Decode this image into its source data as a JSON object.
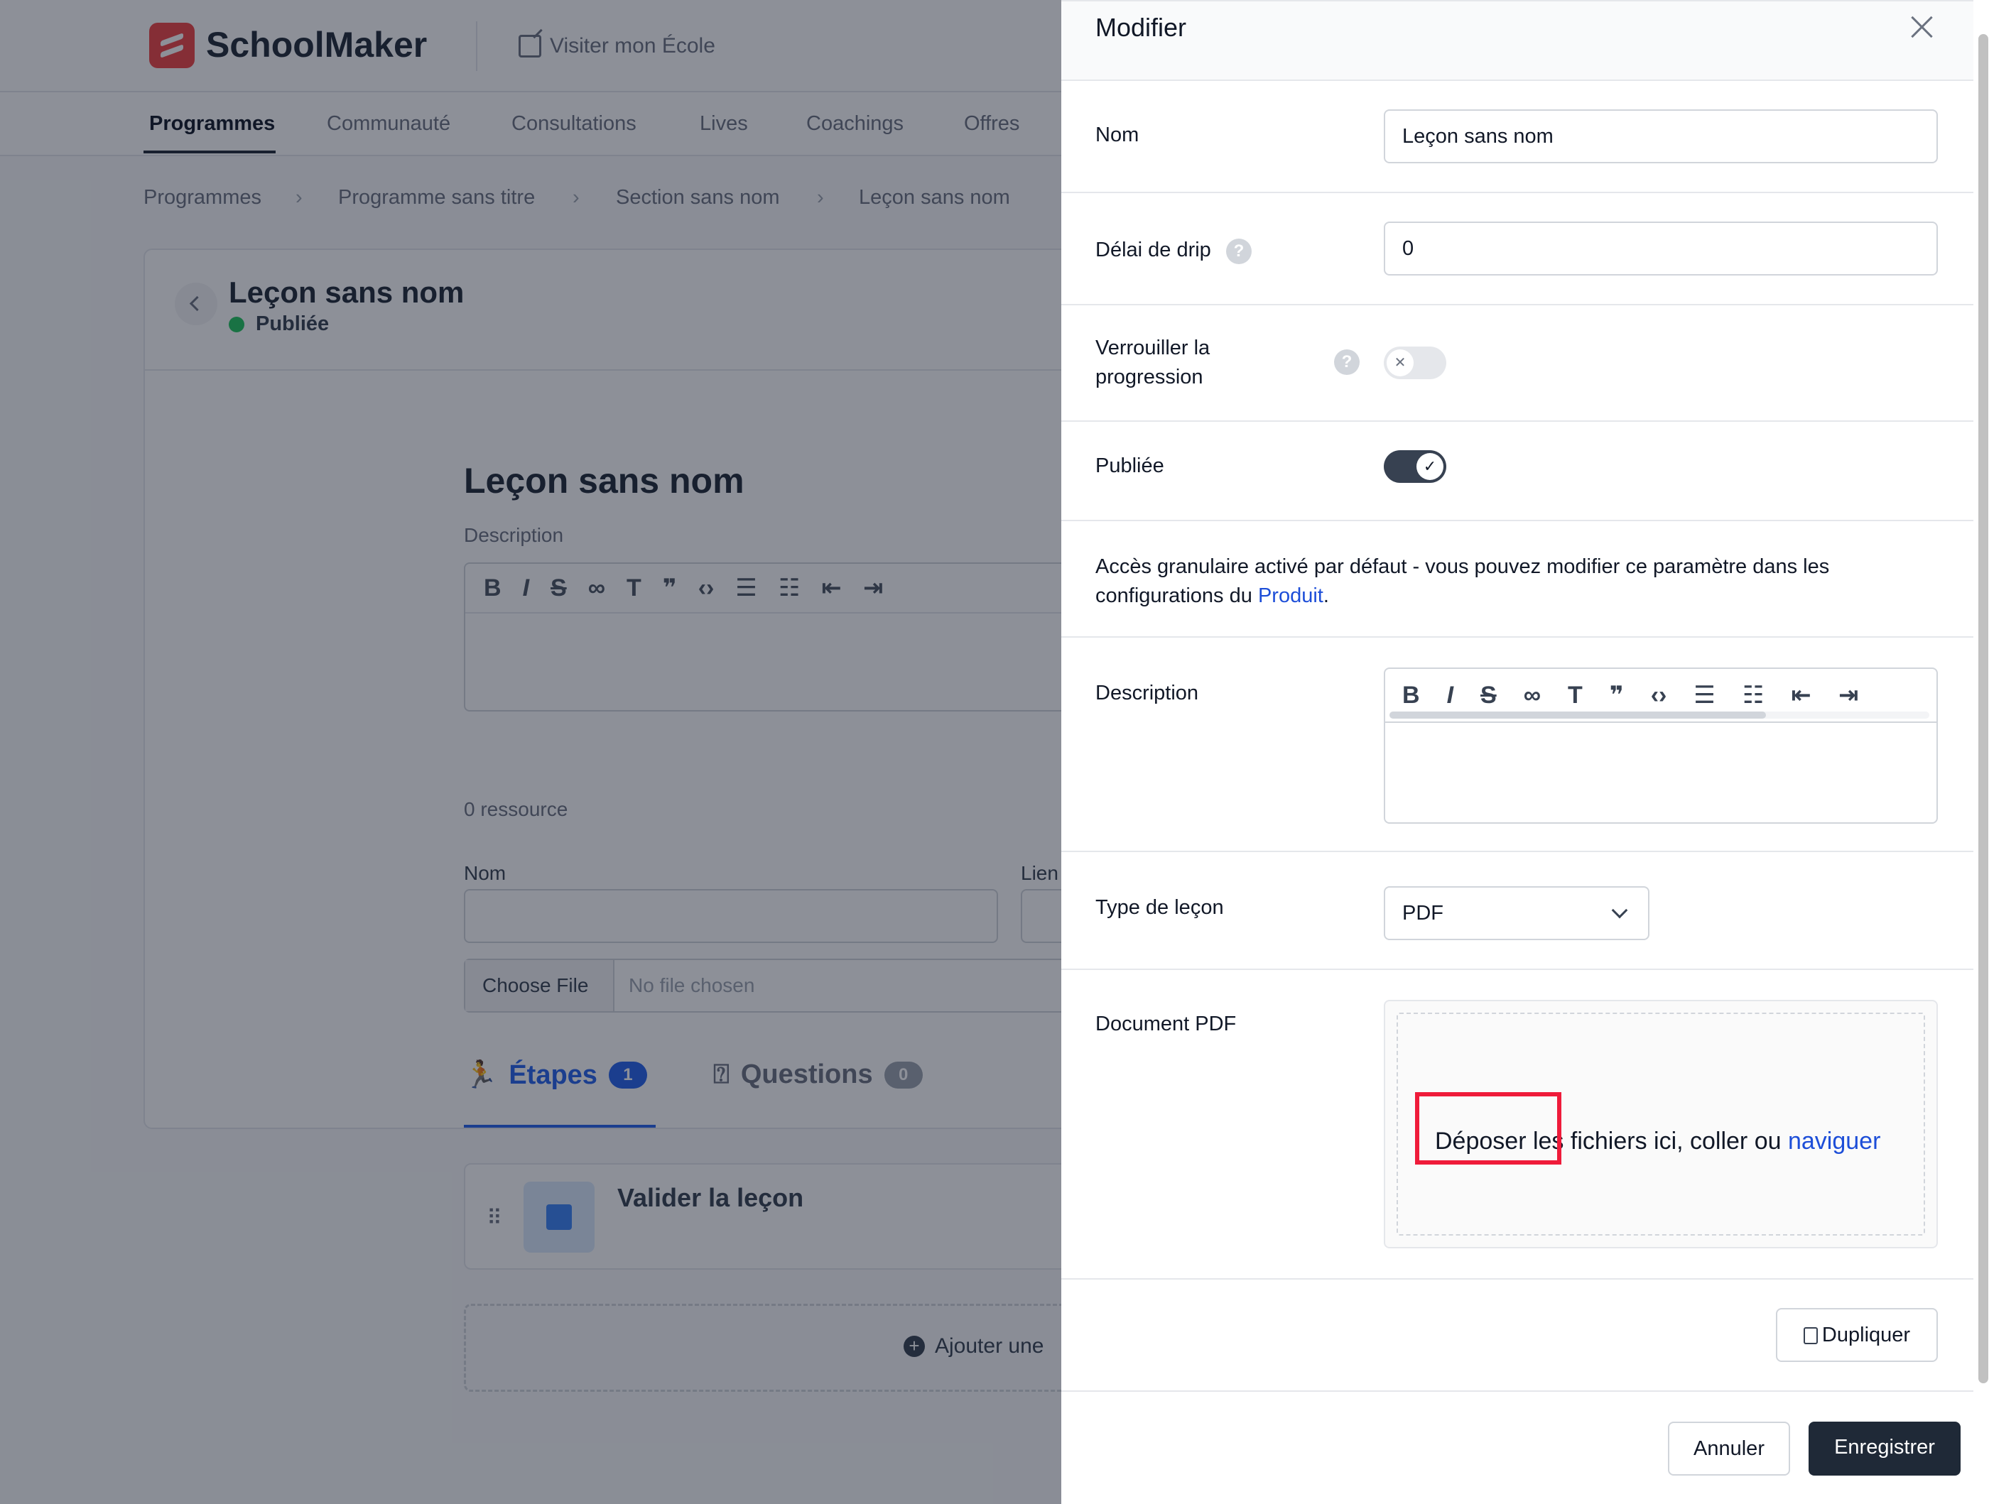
{
  "app": {
    "name": "SchoolMaker",
    "visit_label": "Visiter mon École"
  },
  "nav": {
    "items": [
      "Programmes",
      "Communauté",
      "Consultations",
      "Lives",
      "Coachings",
      "Offres"
    ]
  },
  "breadcrumb": [
    "Programmes",
    "Programme sans titre",
    "Section sans nom",
    "Leçon sans nom"
  ],
  "lesson": {
    "title": "Leçon sans nom",
    "status": "Publiée",
    "heading": "Leçon sans nom",
    "description_label": "Description",
    "resources_count": "0 ressource",
    "name_label": "Nom",
    "link_label": "Lien",
    "choose_file": "Choose File",
    "no_file": "No file chosen",
    "tabs": {
      "steps_label": "Étapes",
      "steps_count": "1",
      "questions_label": "Questions",
      "questions_count": "0"
    },
    "step_title": "Valider la leçon",
    "add_step": "Ajouter une"
  },
  "modal": {
    "title": "Modifier",
    "name_label": "Nom",
    "name_value": "Leçon sans nom",
    "drip_label": "Délai de drip",
    "drip_value": "0",
    "lock_label": "Verrouiller la progression",
    "lock_enabled": false,
    "published_label": "Publiée",
    "published_enabled": true,
    "info_text": "Accès granulaire activé par défaut - vous pouvez modifier ce paramètre dans les configurations du",
    "info_link": "Produit",
    "info_end": ".",
    "description_label": "Description",
    "type_label": "Type de leçon",
    "type_value": "PDF",
    "pdf_label": "Document PDF",
    "dropzone_text": "Déposer les fichiers ici, coller ou",
    "dropzone_link": "naviguer",
    "duplicate_label": "Dupliquer",
    "cancel_label": "Annuler",
    "save_label": "Enregistrer"
  },
  "colors": {
    "accent": "#1d4ed8",
    "dark_button": "#1f2937",
    "highlight": "#ef1b3a",
    "status_dot": "#22c55e"
  }
}
